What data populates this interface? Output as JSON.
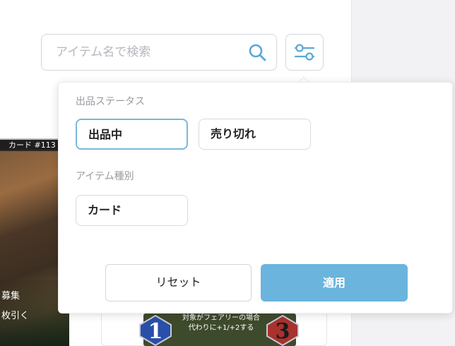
{
  "search": {
    "placeholder": "アイテム名で検索"
  },
  "icons": {
    "search": "search-icon",
    "filter": "sliders-icon"
  },
  "colors": {
    "accent": "#6ab4dd",
    "selected_border": "#7ab7da",
    "label": "#9a9aa2"
  },
  "filter_popover": {
    "status_section": {
      "label": "出品ステータス",
      "options": [
        {
          "label": "出品中",
          "selected": true
        },
        {
          "label": "売り切れ",
          "selected": false
        }
      ]
    },
    "type_section": {
      "label": "アイテム種別",
      "options": [
        {
          "label": "カード",
          "selected": false
        }
      ]
    },
    "reset_label": "リセット",
    "apply_label": "適用"
  },
  "background_cards": {
    "left_card_title": "カード #113",
    "left_card_line1": "募集",
    "left_card_line2": "枚引く",
    "middle_card_text_line1": "対象がフェアリーの場合",
    "middle_card_text_line2": "代わりに+1/+2する",
    "middle_card_left_number": "1",
    "middle_card_right_number": "3"
  }
}
